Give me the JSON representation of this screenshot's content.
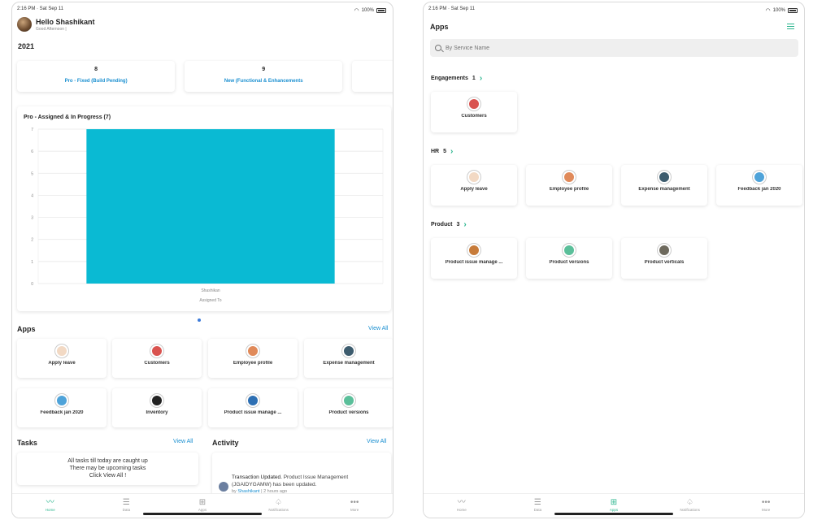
{
  "status": {
    "time": "2:16 PM · Sat Sep 11",
    "battery": "100%"
  },
  "left": {
    "greeting": "Hello Shashikant",
    "subgreeting": "Good Afternoon |",
    "year": "2021",
    "stats": [
      {
        "value": "8",
        "label": "Pro - Fixed (Build Pending)"
      },
      {
        "value": "9",
        "label": "New (Functional & Enhancements"
      }
    ],
    "chart_title": "Pro - Assigned & In Progress (7)",
    "apps_heading": "Apps",
    "apps_view_all": "View All",
    "apps": [
      {
        "label": "Apply leave",
        "color": "#f2d9c4"
      },
      {
        "label": "Customers",
        "color": "#d9534f"
      },
      {
        "label": "Employee profile",
        "color": "#e08a5a"
      },
      {
        "label": "Expense management",
        "color": "#3d5c6e"
      },
      {
        "label": "Feedback jan 2020",
        "color": "#4fa3d9"
      },
      {
        "label": "Inventory",
        "color": "#222222"
      },
      {
        "label": "Product issue manage ...",
        "color": "#2d6fb3"
      },
      {
        "label": "Product versions",
        "color": "#5bbf9a"
      }
    ],
    "tasks_heading": "Tasks",
    "tasks_view_all": "View All",
    "tasks_msg1": "All tasks till today are caught up",
    "tasks_msg2": "There may be upcoming tasks",
    "tasks_msg3": "Click View All !",
    "activity_heading": "Activity",
    "activity_view_all": "View All",
    "activity_title": "Transaction Updated.",
    "activity_body": "Product Issue Management (JGAIDYGAMW) has been updated.",
    "activity_by": "by",
    "activity_user": "Shashikant",
    "activity_time": "2 hours ago"
  },
  "chart_data": {
    "type": "bar",
    "categories": [
      "Shashikan"
    ],
    "values": [
      7
    ],
    "title": "Pro - Assigned & In Progress (7)",
    "xlabel": "Assigned To",
    "ylabel": "",
    "ylim": [
      0,
      7
    ],
    "yticks": [
      0,
      1,
      2,
      3,
      4,
      5,
      6,
      7
    ],
    "bar_color": "#0abad3",
    "grid": true
  },
  "right": {
    "title": "Apps",
    "search_placeholder": "By Service Name",
    "groups": [
      {
        "name": "Engagements",
        "count": "1",
        "apps": [
          {
            "label": "Customers",
            "color": "#d9534f"
          }
        ]
      },
      {
        "name": "HR",
        "count": "5",
        "apps": [
          {
            "label": "Apply leave",
            "color": "#f2d9c4"
          },
          {
            "label": "Employee profile",
            "color": "#e08a5a"
          },
          {
            "label": "Expense management",
            "color": "#3d5c6e"
          },
          {
            "label": "Feedback jan 2020",
            "color": "#4fa3d9"
          }
        ]
      },
      {
        "name": "Product",
        "count": "3",
        "apps": [
          {
            "label": "Product issue manage ...",
            "color": "#c77b3a"
          },
          {
            "label": "Product versions",
            "color": "#5bbf9a"
          },
          {
            "label": "Product verticals",
            "color": "#6e6a5e"
          }
        ]
      }
    ]
  },
  "tabs": [
    {
      "label": "Home",
      "icon": "pulse-icon"
    },
    {
      "label": "Data",
      "icon": "list-icon"
    },
    {
      "label": "Apps",
      "icon": "grid-icon"
    },
    {
      "label": "Notifications",
      "icon": "bell-icon"
    },
    {
      "label": "More",
      "icon": "more-icon"
    }
  ],
  "accent": "#2bb58e"
}
